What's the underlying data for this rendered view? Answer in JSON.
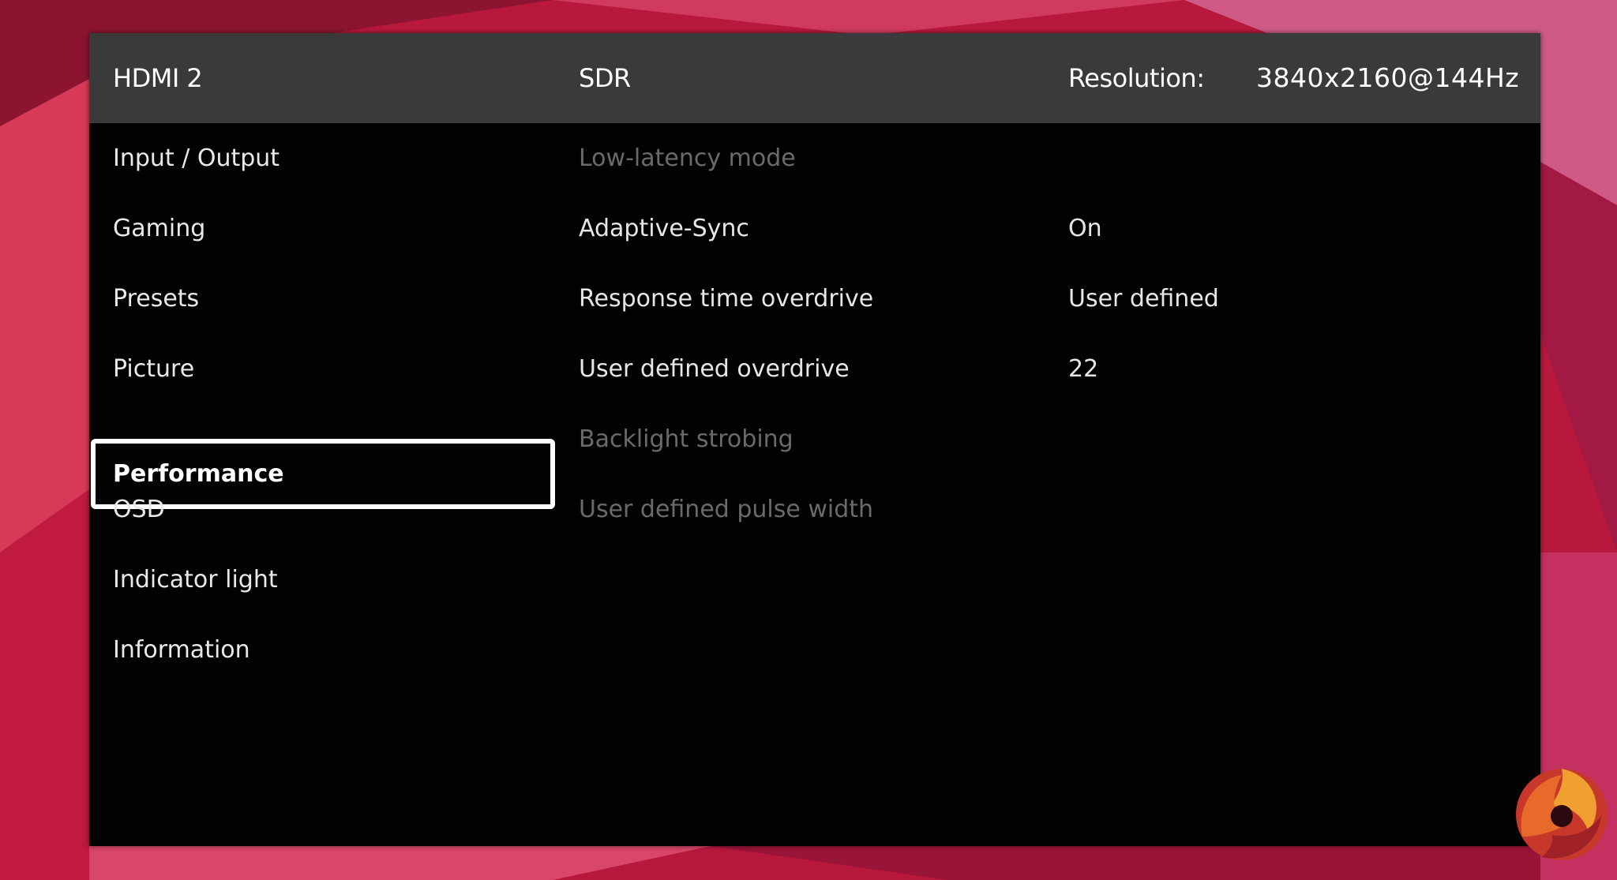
{
  "header": {
    "input": "HDMI 2",
    "mode": "SDR",
    "resolution_label": "Resolution:",
    "resolution_value": "3840x2160@144Hz"
  },
  "nav": {
    "items": [
      {
        "label": "Input / Output"
      },
      {
        "label": "Gaming"
      },
      {
        "label": "Presets"
      },
      {
        "label": "Picture"
      },
      {
        "label": "Performance",
        "active": true
      },
      {
        "label": "OSD"
      },
      {
        "label": "Indicator light"
      },
      {
        "label": "Information"
      }
    ]
  },
  "settings": {
    "rows": [
      {
        "label": "Low-latency mode",
        "value": "",
        "enabled": false
      },
      {
        "label": "Adaptive-Sync",
        "value": "On",
        "enabled": true
      },
      {
        "label": "Response time overdrive",
        "value": "User defined",
        "enabled": true
      },
      {
        "label": "User defined overdrive",
        "value": "22",
        "enabled": true
      },
      {
        "label": "Backlight strobing",
        "value": "",
        "enabled": false
      },
      {
        "label": "User defined pulse width",
        "value": "",
        "enabled": false
      }
    ]
  },
  "colors": {
    "osd_background": "#020202",
    "header_background": "#3a3a3a",
    "text": "#e6e6e6",
    "disabled_text": "#6a6a6a",
    "selection_border": "#ffffff"
  },
  "icons": {
    "watermark": "kitguru-logo-icon"
  }
}
